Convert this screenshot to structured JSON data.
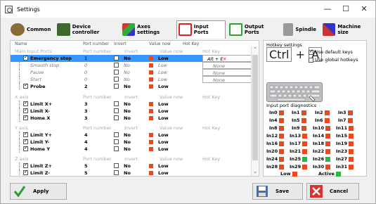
{
  "window": {
    "title": "Settings",
    "minimize": "—",
    "maximize": "☐",
    "close": "✕"
  },
  "tabs": [
    {
      "label": "Common"
    },
    {
      "label": "Device controller"
    },
    {
      "label": "Axes settings"
    },
    {
      "label": "Input Ports"
    },
    {
      "label": "Output Ports"
    },
    {
      "label": "Spindle"
    },
    {
      "label": "Machine size"
    }
  ],
  "active_tab": "Input Ports",
  "grid": {
    "headers": [
      "Name",
      "Port number",
      "Invert",
      "Value now",
      "Hot Key"
    ],
    "groups": {
      "main": {
        "name": "Main Input Ports",
        "port": "Port number",
        "invert": "Invert",
        "value": "Value now",
        "hotkey": "Hot Key"
      },
      "x": {
        "name": "X axis",
        "port": "Port number",
        "invert": "Invert",
        "value": "Value now",
        "hotkey": "Hot Key"
      },
      "y": {
        "name": "Y axis",
        "port": "Port number",
        "invert": "Invert",
        "value": "Value now",
        "hotkey": "Hot Key"
      },
      "z": {
        "name": "Z axis",
        "port": "Port number",
        "invert": "Invert",
        "value": "Value now",
        "hotkey": "Hot Key"
      }
    },
    "rows": [
      {
        "name": "Emergency stop",
        "port": "1",
        "invert": "No",
        "value": "Low",
        "hotkey": "Alt + E"
      },
      {
        "name": "Smooth stop",
        "port": "0",
        "invert": "No",
        "value": "Low",
        "hotkey": "None"
      },
      {
        "name": "Pause",
        "port": "0",
        "invert": "No",
        "value": "Low",
        "hotkey": "None"
      },
      {
        "name": "Start",
        "port": "0",
        "invert": "No",
        "value": "Low",
        "hotkey": "None"
      },
      {
        "name": "Probe",
        "port": "2",
        "invert": "No",
        "value": "Low"
      },
      {
        "name": "Limit X+",
        "port": "3",
        "invert": "No",
        "value": "Low"
      },
      {
        "name": "Limit X-",
        "port": "3",
        "invert": "No",
        "value": "Low"
      },
      {
        "name": "Home X",
        "port": "3",
        "invert": "No",
        "value": "Low"
      },
      {
        "name": "Limit Y+",
        "port": "4",
        "invert": "No",
        "value": "Low"
      },
      {
        "name": "Limit Y-",
        "port": "4",
        "invert": "No",
        "value": "Low"
      },
      {
        "name": "Home Y",
        "port": "4",
        "invert": "No",
        "value": "Low"
      },
      {
        "name": "Limit Z+",
        "port": "5",
        "invert": "No",
        "value": "Low"
      },
      {
        "name": "Limit Z-",
        "port": "5",
        "invert": "No",
        "value": "Low"
      }
    ]
  },
  "hotkeys": {
    "title": "Hotkey settings",
    "ctrl": "Ctrl",
    "plus": "+",
    "key": "A",
    "use_default": "Use default keys",
    "use_global": "Use global hotkeys"
  },
  "diagnostics": {
    "title": "Input port diagnostics",
    "ports": [
      "In0",
      "In1",
      "In2",
      "In3",
      "In4",
      "In5",
      "In6",
      "In7",
      "In8",
      "In9",
      "In10",
      "In11",
      "In12",
      "In13",
      "In14",
      "In15",
      "In16",
      "In17",
      "In18",
      "In19",
      "In20",
      "In21",
      "In22",
      "In23",
      "In24",
      "In25",
      "In26",
      "In27",
      "In28",
      "In29",
      "In30",
      "In31"
    ],
    "low": "Low",
    "active": "Active"
  },
  "buttons": {
    "apply": "Apply",
    "save": "Save",
    "cancel": "Cancel"
  },
  "colors": {
    "led_low": "#e8491d",
    "led_active": "#2bb54a",
    "selection": "#3399ff"
  }
}
